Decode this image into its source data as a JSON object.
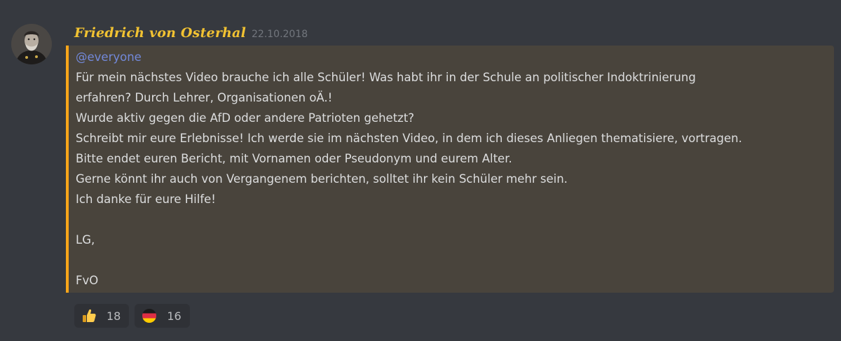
{
  "message": {
    "author": "Friedrich von Osterhal",
    "timestamp": "22.10.2018",
    "mention": "@everyone",
    "lines": [
      "Für mein nächstes Video brauche ich alle Schüler! Was habt ihr in der Schule an politischer Indoktrinierung",
      "erfahren? Durch Lehrer, Organisationen oÄ.!",
      "Wurde aktiv gegen die AfD oder andere Patrioten gehetzt?",
      "Schreibt mir eure Erlebnisse! Ich werde sie im nächsten Video, in dem ich dieses Anliegen thematisiere, vortragen.",
      "Bitte endet euren Bericht, mit Vornamen oder Pseudonym und eurem Alter.",
      "Gerne könnt ihr auch von Vergangenem berichten, solltet ihr kein Schüler mehr sein.",
      "Ich danke für eure Hilfe!",
      "",
      "LG,",
      "",
      "FvO"
    ]
  },
  "reactions": [
    {
      "icon": "thumbs-up-icon",
      "count": "18"
    },
    {
      "icon": "germany-flag-icon",
      "count": "16"
    }
  ],
  "colors": {
    "background": "#36393f",
    "username": "#f1c232",
    "mention_highlight": "#49443c",
    "mention_bar": "#faa61a",
    "mention_text": "#7289da"
  }
}
